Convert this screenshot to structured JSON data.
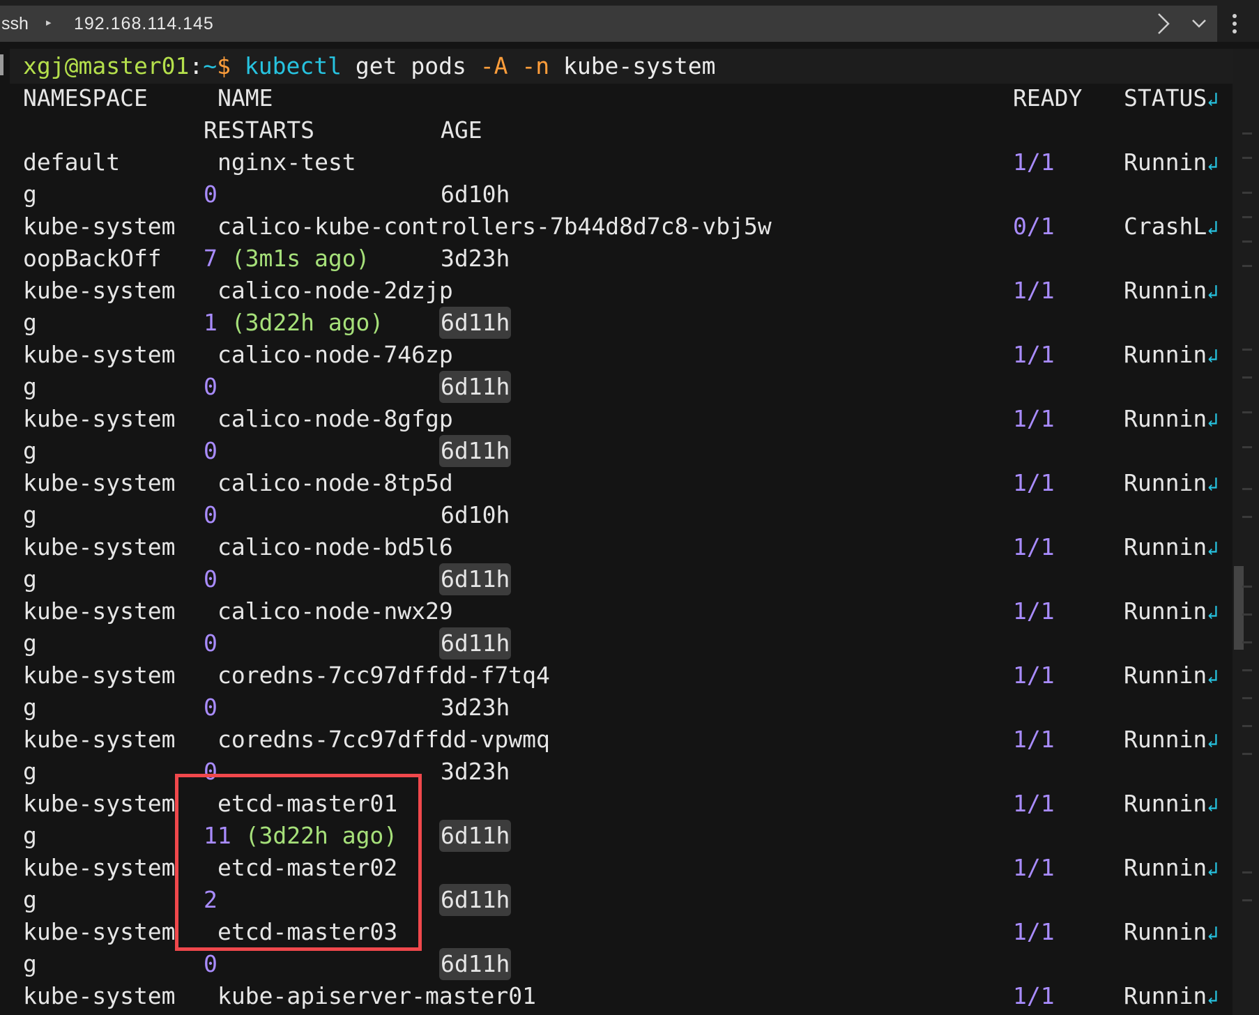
{
  "topbar": {
    "shell": "ssh",
    "host": "192.168.114.145"
  },
  "prompt": {
    "user_host": "xgj@master01",
    "colon": ":",
    "path": "~",
    "symbol": "$",
    "command": "kubectl",
    "args1": "get pods",
    "flag_A": "-A",
    "flag_n": "-n",
    "namespace_arg": "kube-system"
  },
  "header": {
    "namespace": "NAMESPACE",
    "name": "NAME",
    "ready": "READY",
    "status": "STATUS",
    "restarts": "RESTARTS",
    "age": "AGE"
  },
  "rows": [
    {
      "namespace": "default",
      "name": "nginx-test",
      "ready": "1/1",
      "status": "Runnin",
      "status_tail": "g",
      "restarts": "0",
      "restarts_note": "",
      "age": "6d10h",
      "age_highlight": false
    },
    {
      "namespace": "kube-system",
      "name": "calico-kube-controllers-7b44d8d7c8-vbj5w",
      "ready": "0/1",
      "status": "CrashL",
      "status_tail": "oopBackOff",
      "restarts": "7",
      "restarts_note": "(3m1s ago)",
      "age": "3d23h",
      "age_highlight": false
    },
    {
      "namespace": "kube-system",
      "name": "calico-node-2dzjp",
      "ready": "1/1",
      "status": "Runnin",
      "status_tail": "g",
      "restarts": "1",
      "restarts_note": "(3d22h ago)",
      "age": "6d11h",
      "age_highlight": true
    },
    {
      "namespace": "kube-system",
      "name": "calico-node-746zp",
      "ready": "1/1",
      "status": "Runnin",
      "status_tail": "g",
      "restarts": "0",
      "restarts_note": "",
      "age": "6d11h",
      "age_highlight": true
    },
    {
      "namespace": "kube-system",
      "name": "calico-node-8gfgp",
      "ready": "1/1",
      "status": "Runnin",
      "status_tail": "g",
      "restarts": "0",
      "restarts_note": "",
      "age": "6d11h",
      "age_highlight": true
    },
    {
      "namespace": "kube-system",
      "name": "calico-node-8tp5d",
      "ready": "1/1",
      "status": "Runnin",
      "status_tail": "g",
      "restarts": "0",
      "restarts_note": "",
      "age": "6d10h",
      "age_highlight": false
    },
    {
      "namespace": "kube-system",
      "name": "calico-node-bd5l6",
      "ready": "1/1",
      "status": "Runnin",
      "status_tail": "g",
      "restarts": "0",
      "restarts_note": "",
      "age": "6d11h",
      "age_highlight": true
    },
    {
      "namespace": "kube-system",
      "name": "calico-node-nwx29",
      "ready": "1/1",
      "status": "Runnin",
      "status_tail": "g",
      "restarts": "0",
      "restarts_note": "",
      "age": "6d11h",
      "age_highlight": true
    },
    {
      "namespace": "kube-system",
      "name": "coredns-7cc97dffdd-f7tq4",
      "ready": "1/1",
      "status": "Runnin",
      "status_tail": "g",
      "restarts": "0",
      "restarts_note": "",
      "age": "3d23h",
      "age_highlight": false
    },
    {
      "namespace": "kube-system",
      "name": "coredns-7cc97dffdd-vpwmq",
      "ready": "1/1",
      "status": "Runnin",
      "status_tail": "g",
      "restarts": "0",
      "restarts_note": "",
      "age": "3d23h",
      "age_highlight": false
    },
    {
      "namespace": "kube-system",
      "name": "etcd-master01",
      "ready": "1/1",
      "status": "Runnin",
      "status_tail": "g",
      "restarts": "11",
      "restarts_note": "(3d22h ago)",
      "age": "6d11h",
      "age_highlight": true
    },
    {
      "namespace": "kube-system",
      "name": "etcd-master02",
      "ready": "1/1",
      "status": "Runnin",
      "status_tail": "g",
      "restarts": "2",
      "restarts_note": "",
      "age": "6d11h",
      "age_highlight": true
    },
    {
      "namespace": "kube-system",
      "name": "etcd-master03",
      "ready": "1/1",
      "status": "Runnin",
      "status_tail": "g",
      "restarts": "0",
      "restarts_note": "",
      "age": "6d11h",
      "age_highlight": true
    },
    {
      "namespace": "kube-system",
      "name": "kube-apiserver-master01",
      "ready": "1/1",
      "status": "Runnin",
      "status_tail": "",
      "restarts": "",
      "restarts_note": "",
      "age": "",
      "age_highlight": false
    }
  ],
  "colors": {
    "prompt_user": "#b5e04c",
    "prompt_path": "#27c3e0",
    "flags": "#ff9e3b",
    "numbers": "#a98cff",
    "highlight_box": "#f0484c"
  }
}
